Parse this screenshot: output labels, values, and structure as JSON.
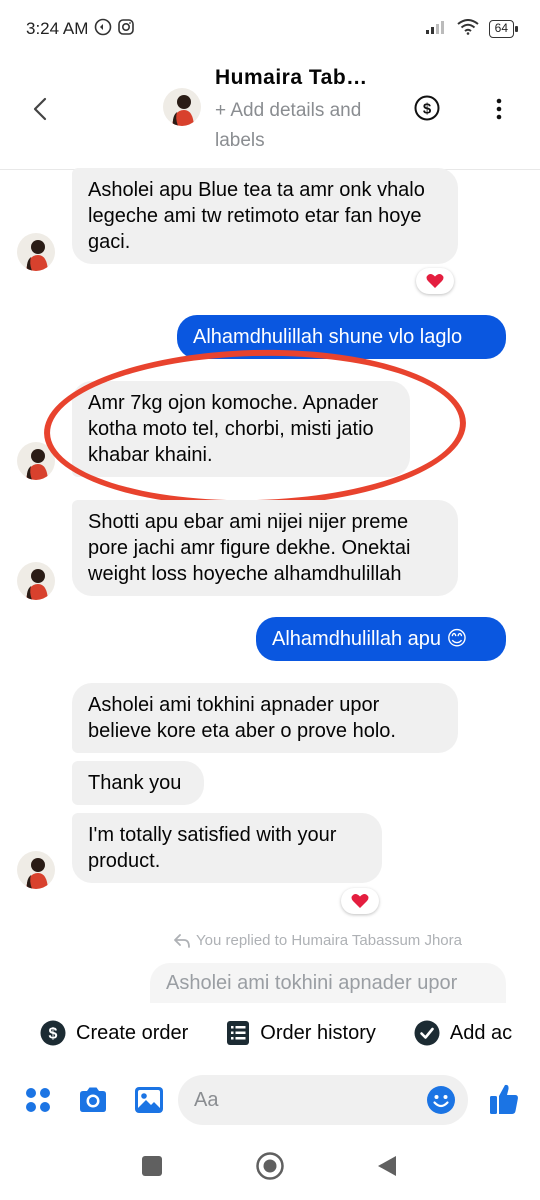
{
  "status_bar": {
    "time": "3:24 AM",
    "battery": "64"
  },
  "header": {
    "contact_name": "Humaira Tab…",
    "add_details": "+ Add details and labels"
  },
  "messages": [
    {
      "type": "received",
      "text": "Asholei apu Blue tea ta amr onk vhalo legeche ami tw retimoto etar fan hoye gaci.",
      "reaction": "heart"
    },
    {
      "type": "sent",
      "text": "Alhamdhulillah shune vlo laglo"
    },
    {
      "type": "received",
      "text": "Amr 7kg ojon komoche. Apnader kotha moto tel, chorbi, misti jatio khabar khaini."
    },
    {
      "type": "received",
      "text": "Shotti apu ebar ami nijei nijer preme pore jachi amr figure dekhe. Onektai weight loss hoyeche alhamdhulillah"
    },
    {
      "type": "sent",
      "text": "Alhamdhulillah apu 😊"
    },
    {
      "type": "received",
      "text": "Asholei ami tokhini apnader upor believe kore eta aber o prove holo."
    },
    {
      "type": "received",
      "text": "Thank you"
    },
    {
      "type": "received",
      "text": "I'm totally satisfied with your product.",
      "reaction": "heart"
    }
  ],
  "reply": {
    "note": "You replied to Humaira Tabassum Jhora",
    "preview": "Asholei ami tokhini apnader upor"
  },
  "quick_actions": [
    {
      "label": "Create order",
      "icon": "dollar-circle-icon"
    },
    {
      "label": "Order history",
      "icon": "list-icon"
    },
    {
      "label": "Add ac",
      "icon": "check-circle-icon"
    }
  ],
  "composer": {
    "placeholder": "Aa"
  },
  "colors": {
    "accent": "#0a57e0",
    "received_bubble": "#f0f0f0",
    "annotation_ring": "#e8432e",
    "icon_blue": "#1b74e4"
  }
}
